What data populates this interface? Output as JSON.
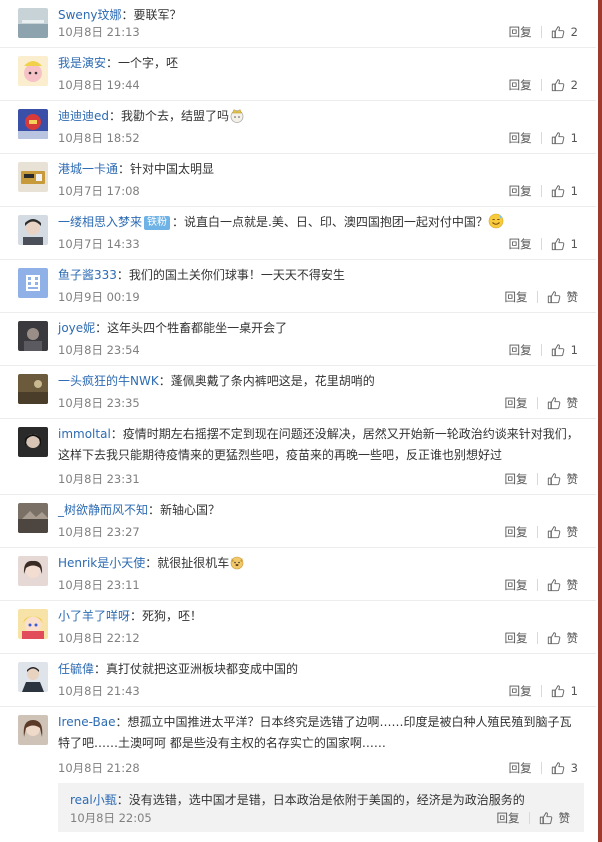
{
  "comments": [
    {
      "user": "Sweny玟娜",
      "text": "：要联军？",
      "time": "10月8日 21:13",
      "likes": "2"
    },
    {
      "user": "我是演安",
      "text": "：一个字，呸",
      "time": "10月8日 19:44",
      "likes": "2"
    },
    {
      "user": "迪迪迪ed",
      "text": "：我勸个去，结盟了吗",
      "time": "10月8日 18:52",
      "likes": "1"
    },
    {
      "user": "港城一卡通",
      "text": "：针对中国太明显",
      "time": "10月7日 17:08",
      "likes": "1"
    },
    {
      "user": "一缕相思入梦来",
      "badge": "铁粉",
      "text": "：说直白一点就是.美、日、印、澳四国抱团一起对付中国？",
      "time": "10月7日 14:33",
      "likes": "1"
    },
    {
      "user": "鱼子酱333",
      "text": "：我们的国土关你们球事！一天天不得安生",
      "time": "10月9日 00:19",
      "likes": "赞"
    },
    {
      "user": "joye妮",
      "text": "：这年头四个牲畜都能坐一桌开会了",
      "time": "10月8日 23:54",
      "likes": "1"
    },
    {
      "user": "一头疯狂的牛NWK",
      "text": "：蓬佩奥戴了条内裤吧这是，花里胡哨的",
      "time": "10月8日 23:35",
      "likes": "赞"
    },
    {
      "user": "immoltal",
      "text": "：疫情时期左右摇摆不定到现在问题还没解决，居然又开始新一轮政治约谈来针对我们，这样下去我只能期待疫情来的更猛烈些吧，疫苗来的再晚一些吧，反正谁也别想好过",
      "time": "10月8日 23:31",
      "likes": "赞"
    },
    {
      "user": "_树欲静而风不知",
      "text": "：新轴心国？",
      "time": "10月8日 23:27",
      "likes": "赞"
    },
    {
      "user": "Henrik是小天使",
      "text": "：就很扯很机车",
      "time": "10月8日 23:11",
      "likes": "赞"
    },
    {
      "user": "小了羊了咩呀",
      "text": "：死狗，呸！",
      "time": "10月8日 22:12",
      "likes": "赞"
    },
    {
      "user": "任毓偉",
      "text": "：真打仗就把这亚洲板块都变成中国的",
      "time": "10月8日 21:43",
      "likes": "1"
    },
    {
      "user": "Irene-Bae",
      "text": "：想孤立中国推进太平洋？日本终究是选错了边啊……印度是被白种人殖民殖到脑子瓦特了吧……土澳呵呵 都是些没有主权的名存实亡的国家啊……",
      "time": "10月8日 21:28",
      "likes": "3"
    }
  ],
  "reply": {
    "user": "real小甄",
    "text": "：没有选错，选中国才是错，日本政治是依附于美国的，经济是为政治服务的",
    "time": "10月8日 22:05",
    "likes": "赞"
  },
  "labels": {
    "reply": "回复"
  },
  "colors": {
    "username": "#2d6bb3",
    "meta": "#808080",
    "badge": "#6fb2e6",
    "sidebar": "#9c3a2e"
  },
  "icons": {
    "like": "thumbs-up-icon",
    "emoji_crown": "crown-emoji-icon",
    "emoji_sweat": "sweat-smile-emoji-icon",
    "emoji_dog": "dog-face-emoji-icon"
  }
}
